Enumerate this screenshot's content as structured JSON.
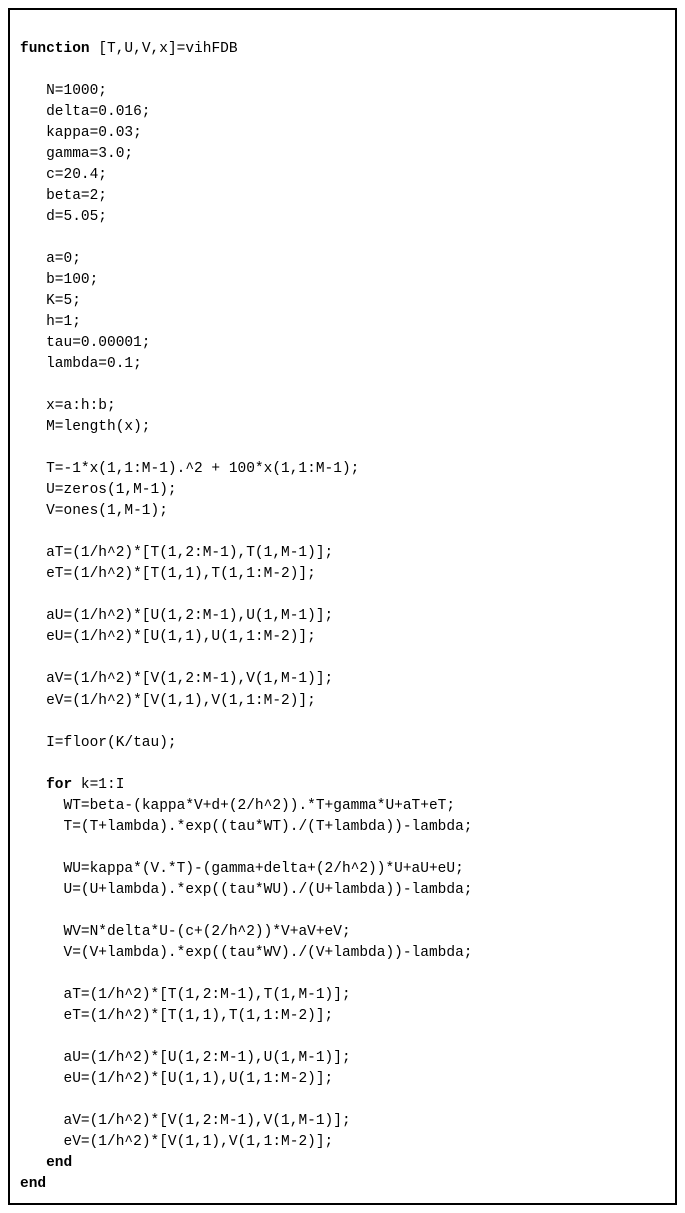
{
  "code": {
    "l0_kw1": "function",
    "l0_rest": " [T,U,V,x]=vihFDB",
    "l1": "",
    "l2": "N=1000;",
    "l3": "delta=0.016;",
    "l4": "kappa=0.03;",
    "l5": "gamma=3.0;",
    "l6": "c=20.4;",
    "l7": "beta=2;",
    "l8": "d=5.05;",
    "l9": "",
    "l10": "a=0;",
    "l11": "b=100;",
    "l12": "K=5;",
    "l13": "h=1;",
    "l14": "tau=0.00001;",
    "l15": "lambda=0.1;",
    "l16": "",
    "l17": "x=a:h:b;",
    "l18": "M=length(x);",
    "l19": "",
    "l20": "T=-1*x(1,1:M-1).^2 + 100*x(1,1:M-1);",
    "l21": "U=zeros(1,M-1);",
    "l22": "V=ones(1,M-1);",
    "l23": "",
    "l24": "aT=(1/h^2)*[T(1,2:M-1),T(1,M-1)];",
    "l25": "eT=(1/h^2)*[T(1,1),T(1,1:M-2)];",
    "l26": "",
    "l27": "aU=(1/h^2)*[U(1,2:M-1),U(1,M-1)];",
    "l28": "eU=(1/h^2)*[U(1,1),U(1,1:M-2)];",
    "l29": "",
    "l30": "aV=(1/h^2)*[V(1,2:M-1),V(1,M-1)];",
    "l31": "eV=(1/h^2)*[V(1,1),V(1,1:M-2)];",
    "l32": "",
    "l33": "I=floor(K/tau);",
    "l34": "",
    "l35_kw": "for",
    "l35_rest": " k=1:I",
    "l36": "WT=beta-(kappa*V+d+(2/h^2)).*T+gamma*U+aT+eT;",
    "l37": "T=(T+lambda).*exp((tau*WT)./(T+lambda))-lambda;",
    "l38": "",
    "l39": "WU=kappa*(V.*T)-(gamma+delta+(2/h^2))*U+aU+eU;",
    "l40": "U=(U+lambda).*exp((tau*WU)./(U+lambda))-lambda;",
    "l41": "",
    "l42": "WV=N*delta*U-(c+(2/h^2))*V+aV+eV;",
    "l43": "V=(V+lambda).*exp((tau*WV)./(V+lambda))-lambda;",
    "l44": "",
    "l45": "aT=(1/h^2)*[T(1,2:M-1),T(1,M-1)];",
    "l46": "eT=(1/h^2)*[T(1,1),T(1,1:M-2)];",
    "l47": "",
    "l48": "aU=(1/h^2)*[U(1,2:M-1),U(1,M-1)];",
    "l49": "eU=(1/h^2)*[U(1,1),U(1,1:M-2)];",
    "l50": "",
    "l51": "aV=(1/h^2)*[V(1,2:M-1),V(1,M-1)];",
    "l52": "eV=(1/h^2)*[V(1,1),V(1,1:M-2)];",
    "l53_kw": "end",
    "l54_kw": "end"
  }
}
